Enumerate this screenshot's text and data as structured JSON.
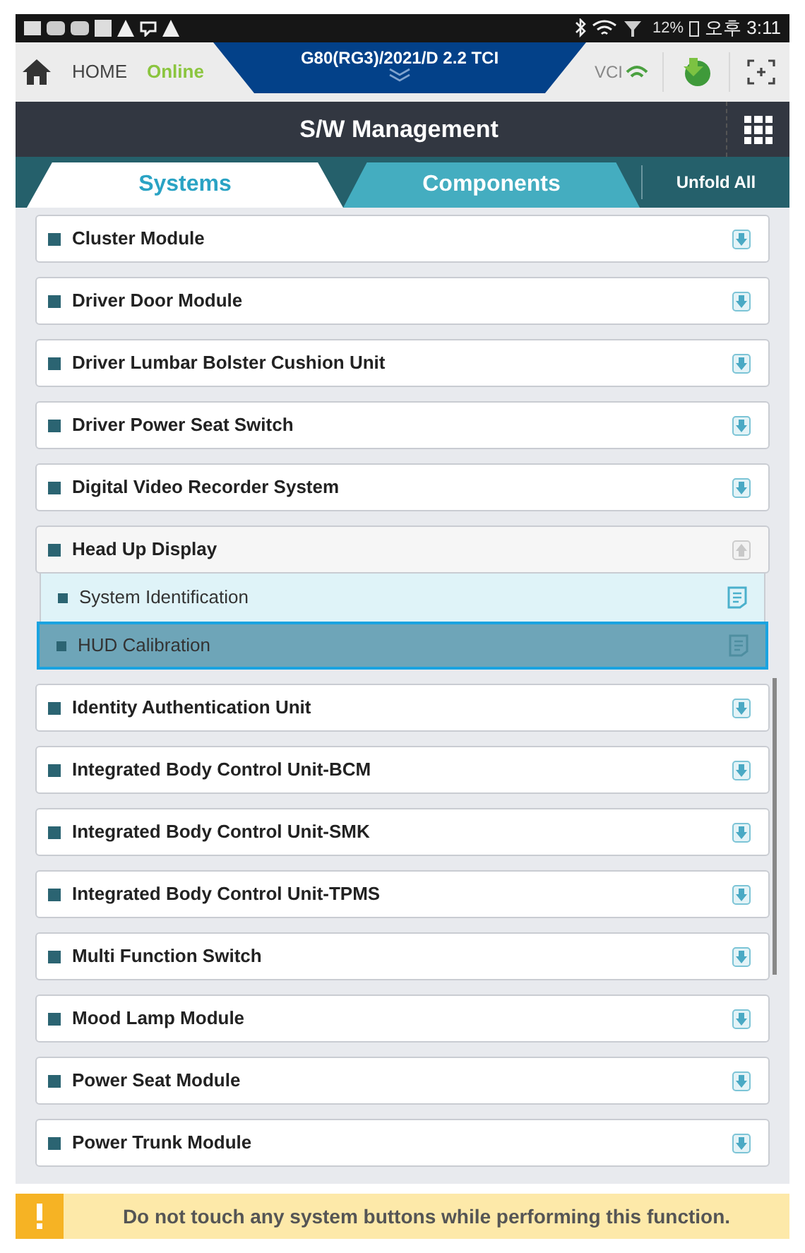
{
  "status_bar": {
    "battery": "12%",
    "time": "오후 3:11"
  },
  "header": {
    "home": "HOME",
    "connection": "Online",
    "vehicle": "G80(RG3)/2021/D 2.2 TCI",
    "vci": "VCI"
  },
  "title": "S/W Management",
  "tabs": [
    {
      "label": "Systems",
      "selected": true
    },
    {
      "label": "Components",
      "selected": false
    }
  ],
  "unfold_button": "Unfold All",
  "systems": [
    {
      "label": "Cluster Module",
      "expanded": false
    },
    {
      "label": "Driver Door Module",
      "expanded": false
    },
    {
      "label": "Driver Lumbar Bolster Cushion Unit",
      "expanded": false
    },
    {
      "label": "Driver Power Seat Switch",
      "expanded": false
    },
    {
      "label": "Digital Video Recorder System",
      "expanded": false
    },
    {
      "label": "Head Up Display",
      "expanded": true,
      "children": [
        {
          "label": "System Identification",
          "selected": false
        },
        {
          "label": "HUD Calibration",
          "selected": true
        }
      ]
    },
    {
      "label": "Identity Authentication Unit",
      "expanded": false
    },
    {
      "label": "Integrated Body Control Unit-BCM",
      "expanded": false
    },
    {
      "label": "Integrated Body Control Unit-SMK",
      "expanded": false
    },
    {
      "label": "Integrated Body Control Unit-TPMS",
      "expanded": false
    },
    {
      "label": "Multi Function Switch",
      "expanded": false
    },
    {
      "label": "Mood Lamp Module",
      "expanded": false
    },
    {
      "label": "Power Seat Module",
      "expanded": false
    },
    {
      "label": "Power Trunk Module",
      "expanded": false
    }
  ],
  "warning": "Do not touch any system buttons while performing this function."
}
